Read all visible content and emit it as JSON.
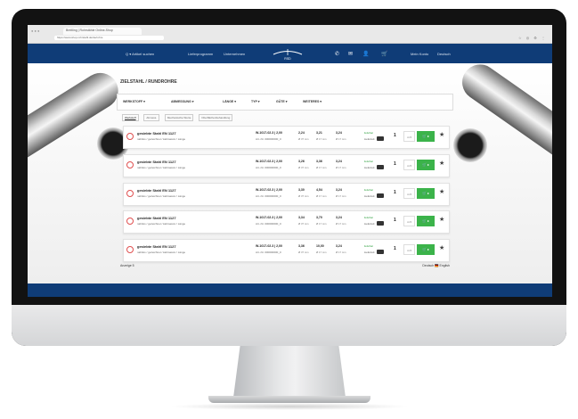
{
  "browser": {
    "tab_title": "Breitling | Rohrstähle Online-Shop",
    "url": "https://www.shop.rohrstahl.de/de/rohre",
    "window_buttons": "● ● ●",
    "toolbar_icons": "☆ ◎ ⚙ ⋮"
  },
  "nav": {
    "search_label": "Q ▾  Artikel suchen",
    "link_1": "Lieferprogramm",
    "link_2": "Unternehmen",
    "logo_text": "RSD",
    "icons": [
      "✆",
      "✉",
      "👤",
      "🛒"
    ],
    "account": "Mein Konto",
    "lang": "Deutsch"
  },
  "page": {
    "title": "ZIELSTAHL / RUNDROHRE",
    "filters": [
      "WERKSTOFF ▾",
      "ABMESSUNG ▾",
      "LÄNGE ▾",
      "TYP ▾",
      "GÜTE ▾",
      "WEITERES ▾"
    ],
    "subtabs": [
      "Werkstoff",
      "Abmess.",
      "Mechanische Werte",
      "Oberflächenbehandlung"
    ],
    "rows": [
      {
        "name": "gesiebte Stahl EN 1127",
        "desc": "nahtlos / gezeichnet / kaltmassiv / Länge",
        "code": "W-1017-02.3 | 2,00",
        "code2": "Art.-Nr. 000000000_0",
        "v1": "2,24",
        "v2": "3,21",
        "v3": "3,24",
        "s1": "Ø 37 mm",
        "s2": "Ø 17 mm",
        "s3": "Ø 17 mm",
        "stock": "lieferbar",
        "stock2": "Lieferzeit",
        "qty": "1",
        "unit": "m ▾",
        "cart": "🛒 ▸"
      },
      {
        "name": "gesiebte Stahl EN 1127",
        "desc": "nahtlos / gezeichnet / kaltmassiv / Länge",
        "code": "W-1017-02.3 | 2,00",
        "code2": "Art.-Nr. 000000000_0",
        "v1": "3,26",
        "v2": "3,36",
        "v3": "3,24",
        "s1": "Ø 37 mm",
        "s2": "Ø 17 mm",
        "s3": "Ø 17 mm",
        "stock": "lieferbar",
        "stock2": "Lieferzeit",
        "qty": "1",
        "unit": "m ▾",
        "cart": "🛒 ▸"
      },
      {
        "name": "gesiebte Stahl EN 1127",
        "desc": "nahtlos / gezeichnet / kaltmassiv / Länge",
        "code": "W-1017-02.3 | 2,00",
        "code2": "Art.-Nr. 000000000_0",
        "v1": "3,30",
        "v2": "4,54",
        "v3": "3,24",
        "s1": "Ø 37 mm",
        "s2": "Ø 17 mm",
        "s3": "Ø 17 mm",
        "stock": "lieferbar",
        "stock2": "Lieferzeit",
        "qty": "1",
        "unit": "m ▾",
        "cart": "🛒 ▸"
      },
      {
        "name": "gesiebte Stahl EN 1127",
        "desc": "nahtlos / gezeichnet / kaltmassiv / Länge",
        "code": "W-1017-02.3 | 2,00",
        "code2": "Art.-Nr. 000000000_0",
        "v1": "3,34",
        "v2": "3,70",
        "v3": "3,24",
        "s1": "Ø 37 mm",
        "s2": "Ø 17 mm",
        "s3": "Ø 17 mm",
        "stock": "lieferbar",
        "stock2": "Lieferzeit",
        "qty": "1",
        "unit": "m ▾",
        "cart": "🛒 ▸"
      },
      {
        "name": "gesiebte Stahl EN 1127",
        "desc": "nahtlos / gezeichnet / kaltmassiv / Länge",
        "code": "W-1017-02.3 | 2,00",
        "code2": "Art.-Nr. 000000000_0",
        "v1": "3,36",
        "v2": "10,00",
        "v3": "3,24",
        "s1": "Ø 37 mm",
        "s2": "Ø 17 mm",
        "s3": "Ø 17 mm",
        "stock": "lieferbar",
        "stock2": "Lieferzeit",
        "qty": "1",
        "unit": "m ▾",
        "cart": "🛒 ▸"
      }
    ],
    "footer_left": "Anzeige  5",
    "footer_right": "Deutsch  🇩🇪  English"
  }
}
